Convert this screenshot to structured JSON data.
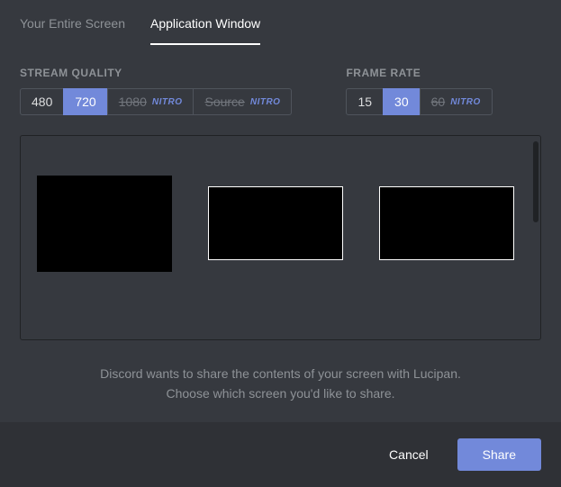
{
  "tabs": {
    "entire_screen": "Your Entire Screen",
    "app_window": "Application Window"
  },
  "stream_quality": {
    "label": "STREAM QUALITY",
    "options": {
      "q480": "480",
      "q720": "720",
      "q1080": "1080",
      "qsource": "Source"
    },
    "nitro_badge": "NITRO"
  },
  "frame_rate": {
    "label": "FRAME RATE",
    "options": {
      "f15": "15",
      "f30": "30",
      "f60": "60"
    },
    "nitro_badge": "NITRO"
  },
  "info": {
    "line1": "Discord wants to share the contents of your screen with Lucipan.",
    "line2": "Choose which screen you'd like to share."
  },
  "footer": {
    "cancel": "Cancel",
    "share": "Share"
  }
}
